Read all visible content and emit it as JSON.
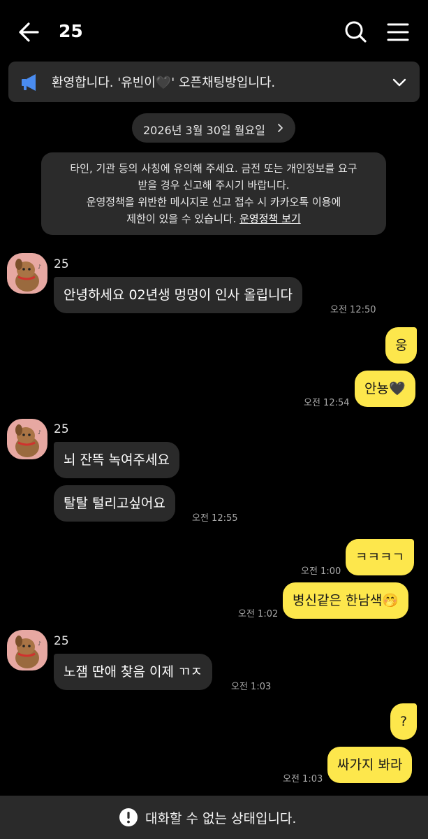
{
  "header": {
    "title": "25",
    "back_icon": "arrow-left-icon",
    "search_icon": "search-icon",
    "menu_icon": "hamburger-menu-icon"
  },
  "notice": {
    "text": "환영합니다. '유빈이🖤' 오픈채팅방입니다.",
    "icon": "megaphone-icon",
    "chevron": "chevron-down-icon"
  },
  "date_divider": {
    "text": "2026년 3월 30일 월요일"
  },
  "warning": {
    "line1": "타인, 기관 등의 사칭에 유의해 주세요. 금전 또는 개인정보를 요구",
    "line2": "받을 경우 신고해 주시기 바랍니다.",
    "line3": "운영정책을 위반한 메시지로 신고 접수 시 카카오톡 이용에",
    "line4_prefix": "제한이 있을 수 있습니다. ",
    "link": "운영정책 보기"
  },
  "messages": [
    {
      "sender": "25",
      "text": "안녕하세요 02년생 멍멍이 인사 올립니다",
      "time": "오전 12:50"
    },
    {
      "text": "웅"
    },
    {
      "text": "안뇽🖤",
      "time": "오전 12:54"
    },
    {
      "sender": "25",
      "text": "뇌 잔뜩 녹여주세요"
    },
    {
      "text": "탈탈 털리고싶어요",
      "time": "오전 12:55"
    },
    {
      "text": "ㅋㅋㅋㄱ",
      "time": "오전 1:00"
    },
    {
      "text": "병신같은 한남색🤭",
      "time": "오전 1:02"
    },
    {
      "sender": "25",
      "text": "노잼 딴애 찾음 이제 ㄲㅈ",
      "time": "오전 1:03"
    },
    {
      "text": "?"
    },
    {
      "text": "싸가지 봐라",
      "time": "오전 1:03"
    }
  ],
  "footer": {
    "text": "대화할 수 없는 상태입니다.",
    "icon": "exclamation-circle-icon"
  },
  "colors": {
    "background": "#000000",
    "incoming_bubble": "#2a2a2a",
    "outgoing_bubble": "#fde74c",
    "panel": "#2b2b2b"
  }
}
